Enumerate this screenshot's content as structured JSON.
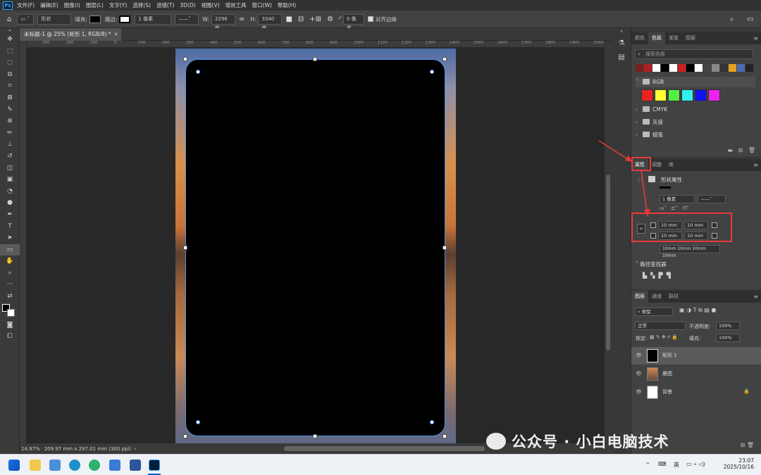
{
  "app": {
    "logo": "Ps",
    "menu": [
      "文件(F)",
      "编辑(E)",
      "图像(I)",
      "图层(L)",
      "文字(Y)",
      "选择(S)",
      "滤镜(T)",
      "3D(D)",
      "视图(V)",
      "增效工具",
      "窗口(W)",
      "帮助(H)"
    ]
  },
  "options": {
    "mode": "形状",
    "fill_label": "填充:",
    "stroke_label": "描边:",
    "stroke_width": "1 像素",
    "w_label": "W:",
    "w_value": "2296 像",
    "h_label": "H:",
    "h_value": "3340 像",
    "radius": "0 像素",
    "align_edges": "对齐边缘"
  },
  "document": {
    "tab": "未标题-1 @ 25% (矩形 1, RGB/8) *",
    "close": "×",
    "zoom": "24.97%",
    "size": "209.97 mm x 297.01 mm (300 ppi)"
  },
  "ruler": {
    "ticks": [
      "300",
      "200",
      "100",
      "0",
      "100",
      "200",
      "300",
      "400",
      "500",
      "600",
      "700",
      "800",
      "900",
      "1000",
      "1100",
      "1200",
      "1300",
      "1400",
      "1500",
      "1600",
      "1700",
      "1800",
      "1900",
      "2000"
    ]
  },
  "swatches_panel": {
    "tabs": [
      "颜色",
      "色板",
      "渐变",
      "图案"
    ],
    "active": 1,
    "search_placeholder": "搜索色板",
    "recent": [
      "#7a1e1e",
      "#b02020",
      "#ffffff",
      "#000000",
      "#ffffff",
      "#c82020",
      "#000000",
      "#ffffff",
      "#444444",
      "#888888",
      "#333333",
      "#e8a020",
      "#4a6ab0",
      "#222222"
    ],
    "groups": [
      {
        "name": "RGB",
        "open": true
      },
      {
        "name": "CMYK"
      },
      {
        "name": "灰度"
      },
      {
        "name": "蜡笔"
      }
    ],
    "rgb_colors": [
      "#ee2222",
      "#ffff33",
      "#55ee44",
      "#33eeee",
      "#1111ee",
      "#ee22ee"
    ]
  },
  "properties_panel": {
    "tabs": [
      "属性",
      "调整",
      "库"
    ],
    "active": 0,
    "title": "形状属性",
    "stroke_width": "1 像素",
    "corners": [
      "10 mm",
      "10 mm",
      "10 mm",
      "10 mm"
    ],
    "corner_summary": "10mm 10mm 10mm 10mm",
    "pathfinder": "路径查找器"
  },
  "layers_panel": {
    "tabs": [
      "图层",
      "通道",
      "路径"
    ],
    "active": 0,
    "filter": "类型",
    "blend": "正常",
    "opacity_label": "不透明度:",
    "opacity": "100%",
    "lock_label": "锁定:",
    "fill_label": "填充:",
    "fill": "100%",
    "layers": [
      {
        "name": "矩形 1",
        "selected": true
      },
      {
        "name": "晨图"
      },
      {
        "name": "背景",
        "locked": true
      }
    ]
  },
  "taskbar": {
    "time": "23:07",
    "date": "2025/10/16",
    "ime": "英"
  },
  "watermark": "公众号 · 小白电脑技术",
  "colors": {
    "selection": "#3b87e8",
    "annotation": "#e83a3a"
  }
}
